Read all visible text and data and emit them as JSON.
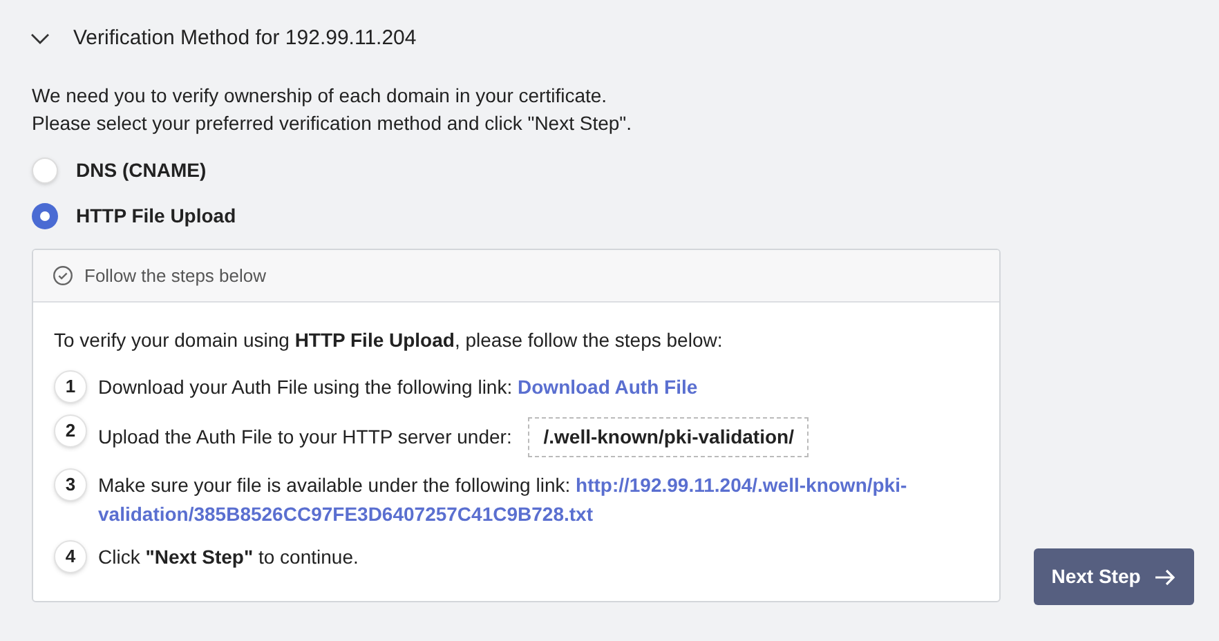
{
  "section": {
    "title": "Verification Method for 192.99.11.204",
    "expanded": true
  },
  "intro": [
    "We need you to verify ownership of each domain in your certificate.",
    "Please select your preferred verification method and click \"Next Step\"."
  ],
  "methods": [
    {
      "label": "DNS (CNAME)",
      "selected": false
    },
    {
      "label": "HTTP File Upload",
      "selected": true
    }
  ],
  "steps_panel": {
    "header": "Follow the steps below",
    "lead": "To verify your domain using **HTTP File Upload**, please follow the steps below:",
    "steps": [
      {
        "number": "1",
        "parts": [
          {
            "kind": "text",
            "text": "Download your Auth File using the following link:"
          },
          {
            "kind": "link",
            "text": "Download Auth File"
          }
        ]
      },
      {
        "number": "2",
        "parts": [
          {
            "kind": "text",
            "text": "Upload the Auth File to your HTTP server under:"
          },
          {
            "kind": "path",
            "text": "/.well-known/pki-validation/"
          }
        ]
      },
      {
        "number": "3",
        "parts": [
          {
            "kind": "text",
            "text": "Make sure your file is available under the following link:"
          },
          {
            "kind": "link",
            "text": "http://192.99.11.204/.well-known/pki-"
          },
          {
            "kind": "link_cont",
            "text": "validation/385B8526CC97FE3D6407257C41C9B728.txt"
          }
        ]
      },
      {
        "number": "4",
        "parts": [
          {
            "kind": "text",
            "text": "Click **\"Next Step\"** to continue."
          }
        ]
      }
    ]
  },
  "next_button": "Next Step"
}
